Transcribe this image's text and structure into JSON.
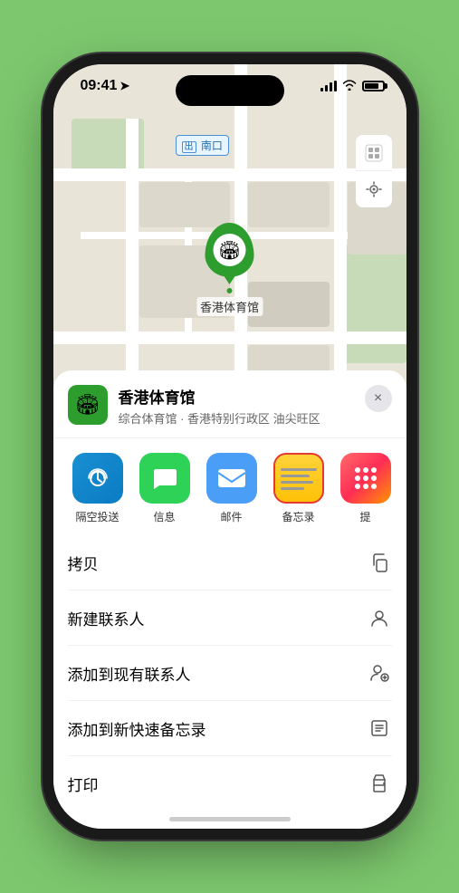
{
  "statusBar": {
    "time": "09:41",
    "timeIcon": "location-arrow"
  },
  "mapLabel": {
    "text": "南口",
    "prefix": "出口"
  },
  "mapPin": {
    "label": "香港体育馆",
    "emoji": "🏟"
  },
  "mapControls": {
    "layerBtn": "🗺",
    "locationBtn": "➤"
  },
  "venue": {
    "name": "香港体育馆",
    "description": "综合体育馆 · 香港特别行政区 油尖旺区",
    "emoji": "🏟"
  },
  "shareItems": [
    {
      "id": "airdrop",
      "label": "隔空投送",
      "type": "airdrop"
    },
    {
      "id": "messages",
      "label": "信息",
      "type": "messages"
    },
    {
      "id": "mail",
      "label": "邮件",
      "type": "mail"
    },
    {
      "id": "notes",
      "label": "备忘录",
      "type": "notes"
    },
    {
      "id": "more",
      "label": "提",
      "type": "more"
    }
  ],
  "actions": [
    {
      "id": "copy",
      "label": "拷贝",
      "icon": "copy"
    },
    {
      "id": "new-contact",
      "label": "新建联系人",
      "icon": "person"
    },
    {
      "id": "add-contact",
      "label": "添加到现有联系人",
      "icon": "person-plus"
    },
    {
      "id": "quick-note",
      "label": "添加到新快速备忘录",
      "icon": "note"
    },
    {
      "id": "print",
      "label": "打印",
      "icon": "print"
    }
  ],
  "closeBtn": "×"
}
